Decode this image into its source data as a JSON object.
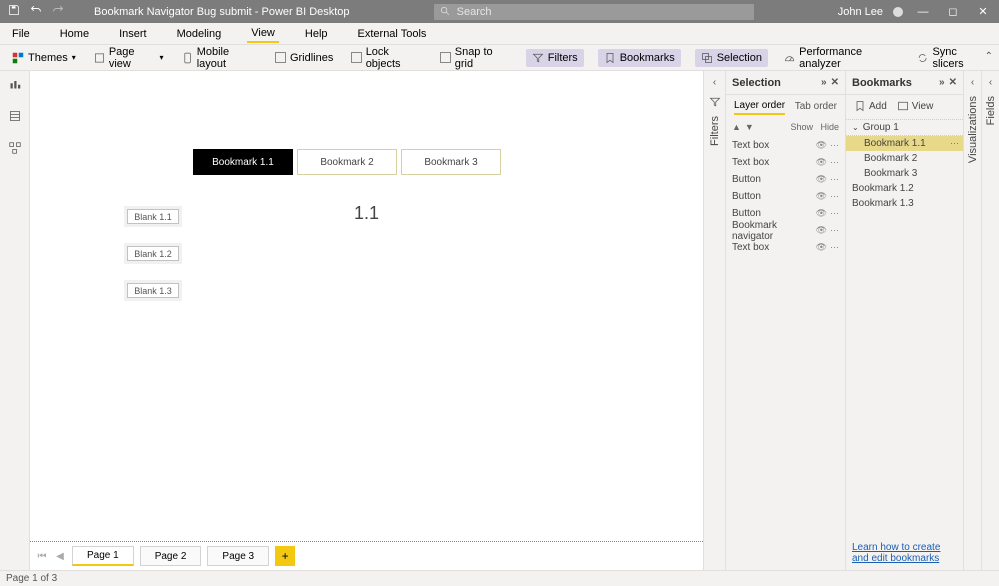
{
  "titlebar": {
    "title": "Bookmark Navigator Bug submit - Power BI Desktop",
    "search_placeholder": "Search",
    "user": "John Lee"
  },
  "menu": [
    "File",
    "Home",
    "Insert",
    "Modeling",
    "View",
    "Help",
    "External Tools"
  ],
  "menu_active": "View",
  "ribbon": {
    "themes": "Themes",
    "pageview": "Page view",
    "mobile": "Mobile layout",
    "gridlines": "Gridlines",
    "lock": "Lock objects",
    "snap": "Snap to grid",
    "filters": "Filters",
    "bookmarks": "Bookmarks",
    "selection": "Selection",
    "perf": "Performance analyzer",
    "sync": "Sync slicers"
  },
  "canvas": {
    "tabs": [
      "Bookmark 1.1",
      "Bookmark 2",
      "Bookmark 3"
    ],
    "active_tab": 0,
    "blanks": [
      "Blank 1.1",
      "Blank 1.2",
      "Blank 1.3"
    ],
    "big_text": "1.1"
  },
  "page_tabs": [
    "Page 1",
    "Page 2",
    "Page 3"
  ],
  "page_active": 0,
  "filters_label": "Filters",
  "selection_panel": {
    "title": "Selection",
    "tabs": [
      "Layer order",
      "Tab order"
    ],
    "active_tab": 0,
    "show": "Show",
    "hide": "Hide",
    "items": [
      "Text box",
      "Text box",
      "Button",
      "Button",
      "Button",
      "Bookmark navigator",
      "Text box"
    ]
  },
  "bookmarks_panel": {
    "title": "Bookmarks",
    "add": "Add",
    "view": "View",
    "group": "Group 1",
    "group_items": [
      "Bookmark 1.1",
      "Bookmark 2",
      "Bookmark 3"
    ],
    "group_selected": 0,
    "items": [
      "Bookmark 1.2",
      "Bookmark 1.3"
    ],
    "footer": "Learn how to create and edit bookmarks"
  },
  "viz_label": "Visualizations",
  "fields_label": "Fields",
  "status": "Page 1 of 3"
}
